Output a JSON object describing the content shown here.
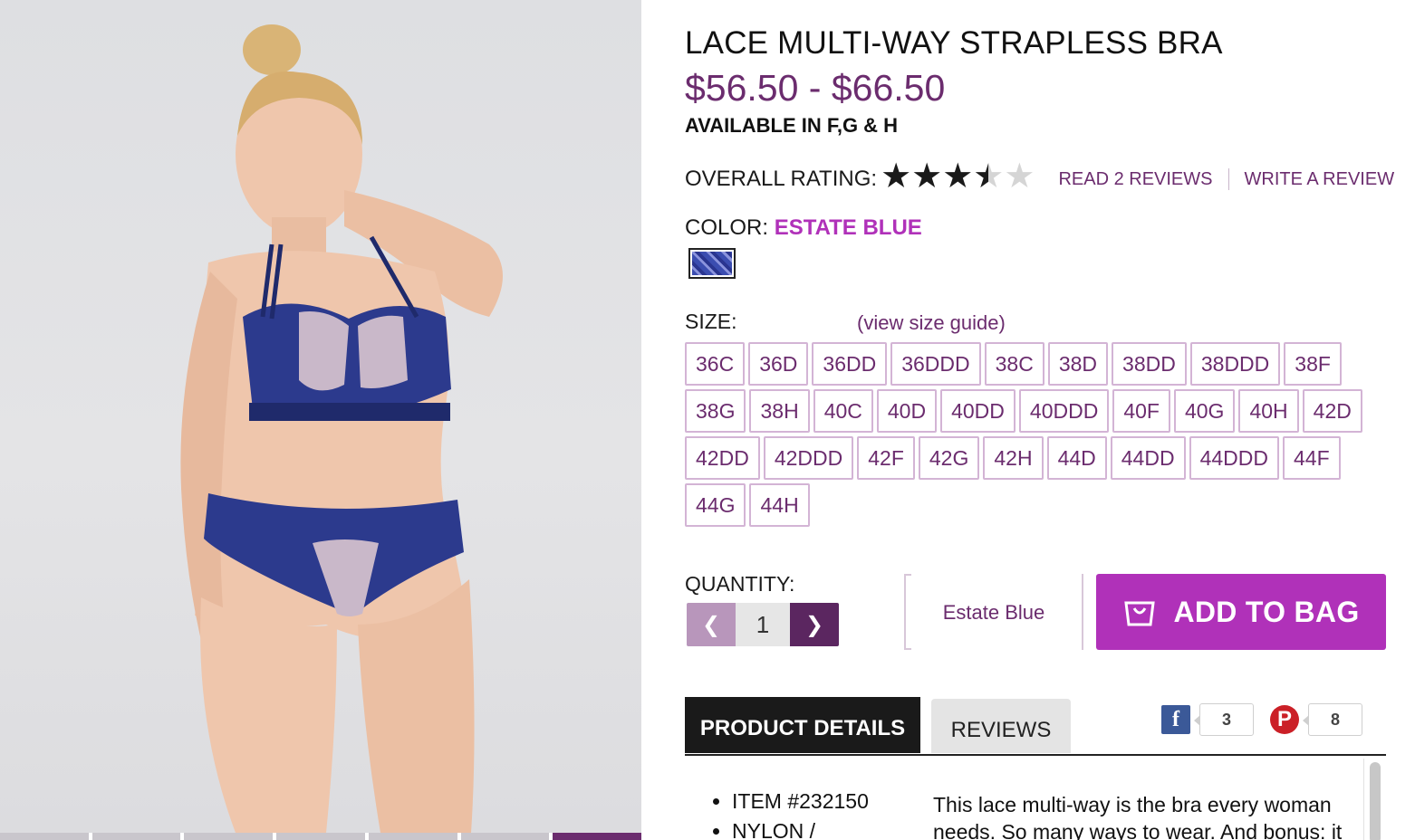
{
  "product": {
    "title": "LACE MULTI-WAY STRAPLESS BRA",
    "price": "$56.50 - $66.50",
    "availability": "AVAILABLE IN F,G & H"
  },
  "rating": {
    "label": "OVERALL RATING:",
    "value": 3.5,
    "max": 5,
    "read_reviews": "READ 2 REVIEWS",
    "write_review": "WRITE A REVIEW"
  },
  "color": {
    "label": "COLOR:",
    "value": "ESTATE BLUE"
  },
  "size": {
    "label": "SIZE:",
    "guide_link": "(view size guide)",
    "options": [
      "36C",
      "36D",
      "36DD",
      "36DDD",
      "38C",
      "38D",
      "38DD",
      "38DDD",
      "38F",
      "38G",
      "38H",
      "40C",
      "40D",
      "40DD",
      "40DDD",
      "40F",
      "40G",
      "40H",
      "42D",
      "42DD",
      "42DDD",
      "42F",
      "42G",
      "42H",
      "44D",
      "44DD",
      "44DDD",
      "44F",
      "44G",
      "44H"
    ]
  },
  "quantity": {
    "label": "QUANTITY:",
    "value": "1"
  },
  "selection": {
    "color_text": "Estate Blue"
  },
  "cart": {
    "add_label": "ADD TO BAG"
  },
  "tabs": {
    "details": "PRODUCT DETAILS",
    "reviews": "REVIEWS"
  },
  "social": {
    "facebook_count": "3",
    "pinterest_count": "8"
  },
  "details": {
    "item": "ITEM #232150",
    "material": "NYLON /",
    "description": "This lace multi-way is the bra every woman needs. So many ways to wear. And bonus: it"
  },
  "colors": {
    "accent": "#6b2c6e",
    "brand_button": "#b031b9",
    "color_value": "#b031b9"
  }
}
